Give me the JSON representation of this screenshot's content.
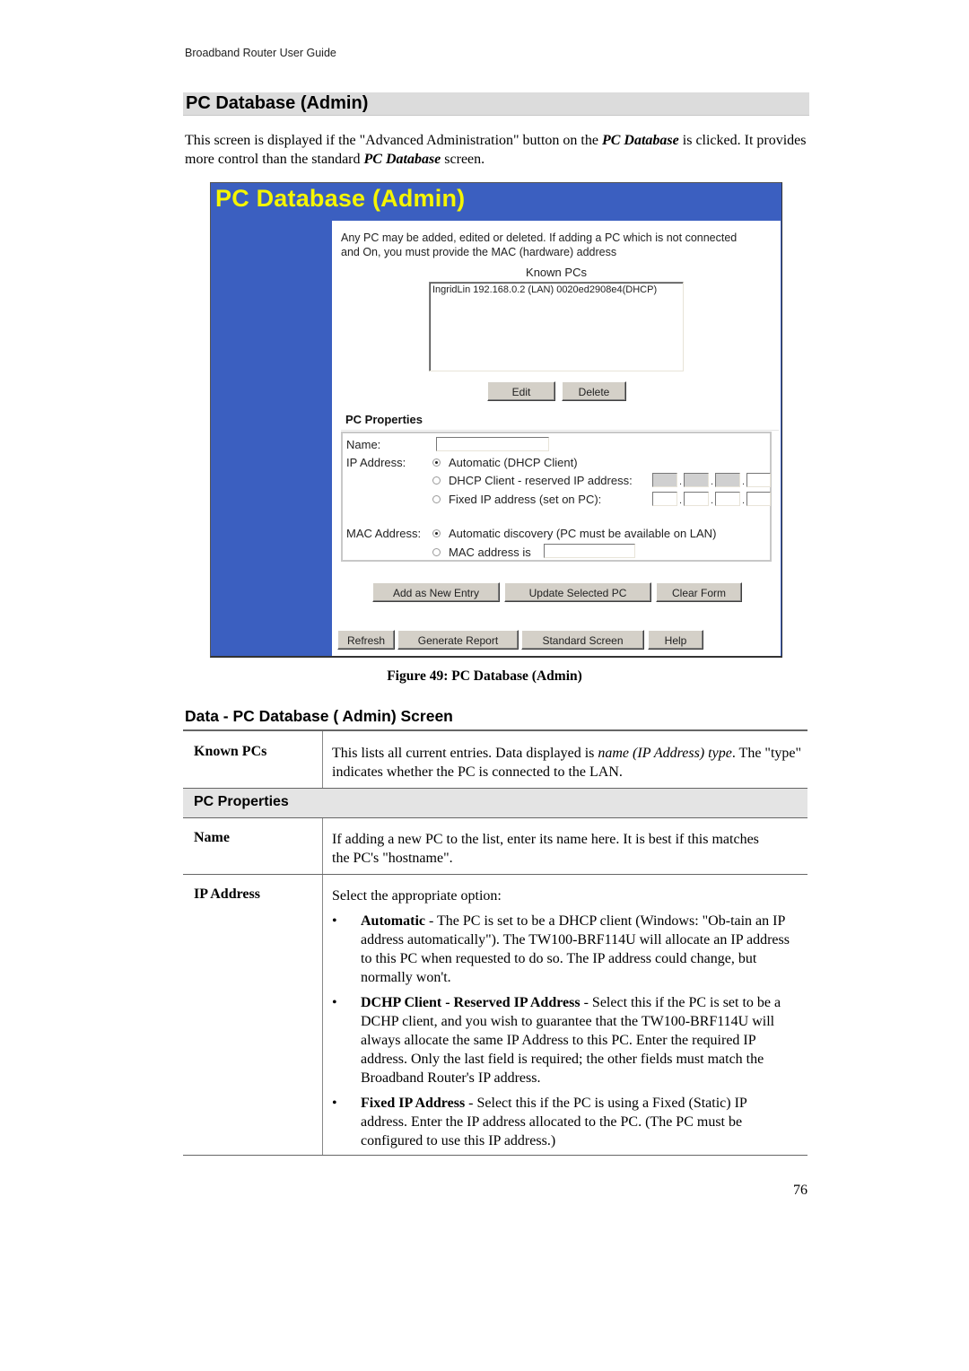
{
  "header": {
    "running_title": "Broadband Router User Guide"
  },
  "section": {
    "title": "PC Database (Admin)"
  },
  "intro": {
    "part1": "This screen is displayed if the \"Advanced Administration\" button on the ",
    "em1": "PC Database",
    "part2": " is clicked. It provides more control than the standard ",
    "em2": "PC Database",
    "part3": " screen."
  },
  "screenshot": {
    "title": "PC Database (Admin)",
    "instructions": "Any PC may be added, edited or deleted. If adding a PC which is not connected and On, you must provide the MAC (hardware) address",
    "known_pcs_label": "Known PCs",
    "known_pcs": [
      "IngridLin 192.168.0.2 (LAN) 0020ed2908e4(DHCP)"
    ],
    "edit_button": "Edit",
    "delete_button": "Delete",
    "pc_properties_heading": "PC Properties",
    "name_label": "Name:",
    "name_value": "",
    "ip_label": "IP Address:",
    "ip_options": [
      {
        "label": "Automatic (DHCP Client)",
        "selected": true
      },
      {
        "label": "DHCP Client - reserved IP address:",
        "selected": false
      },
      {
        "label": "Fixed IP address (set on PC):",
        "selected": false
      }
    ],
    "reserved_ip_octets": [
      "",
      "",
      "",
      ""
    ],
    "fixed_ip_octets": [
      "",
      "",
      "",
      ""
    ],
    "mac_label": "MAC Address:",
    "mac_options": [
      {
        "label": "Automatic discovery (PC must be available on LAN)",
        "selected": true
      },
      {
        "label": "MAC address is",
        "selected": false
      }
    ],
    "mac_value": "",
    "action_buttons": [
      "Add as New Entry",
      "Update Selected PC",
      "Clear Form"
    ],
    "footer_buttons": [
      "Refresh",
      "Generate Report",
      "Standard Screen",
      "Help"
    ],
    "colors": {
      "background": "#3b5fc0",
      "title": "#f5f500",
      "button": "#d4d0c8"
    }
  },
  "figure_caption": "Figure 49: PC Database (Admin)",
  "data_section": {
    "title": "Data - PC Database ( Admin) Screen",
    "known_pcs": {
      "term": "Known PCs",
      "desc_part1": "This lists all current entries. Data displayed is ",
      "desc_em": "name (IP Address) type",
      "desc_part2": ". The \"type\" indicates whether the PC is connected to the LAN."
    },
    "band": "PC Properties",
    "name": {
      "term": "Name",
      "desc": "If adding a new PC to the list, enter its name here. It is best if this matches the PC's \"hostname\"."
    },
    "ip_address": {
      "term": "IP Address",
      "intro": "Select the appropriate option:",
      "bullets": [
        {
          "bold": "Automatic",
          "text": " - The PC is set to be a DHCP client (Windows: \"Ob-tain an IP address automatically\"). The TW100-BRF114U will allocate an IP address to this PC when requested to do so. The IP address could change, but normally won't."
        },
        {
          "bold": "DCHP Client - Reserved IP Address",
          "text": " - Select this if the PC is set to be a DCHP client, and you wish to guarantee that the TW100-BRF114U will always allocate the same IP Address to this PC. Enter the required IP address. Only the last field is required; the other fields must match the Broadband Router's IP address."
        },
        {
          "bold": "Fixed IP Address",
          "text": " - Select this if the PC is using a Fixed (Static) IP address. Enter the IP address allocated to the PC. (The PC must be configured to use this IP address.)"
        }
      ]
    }
  },
  "page_number": "76"
}
